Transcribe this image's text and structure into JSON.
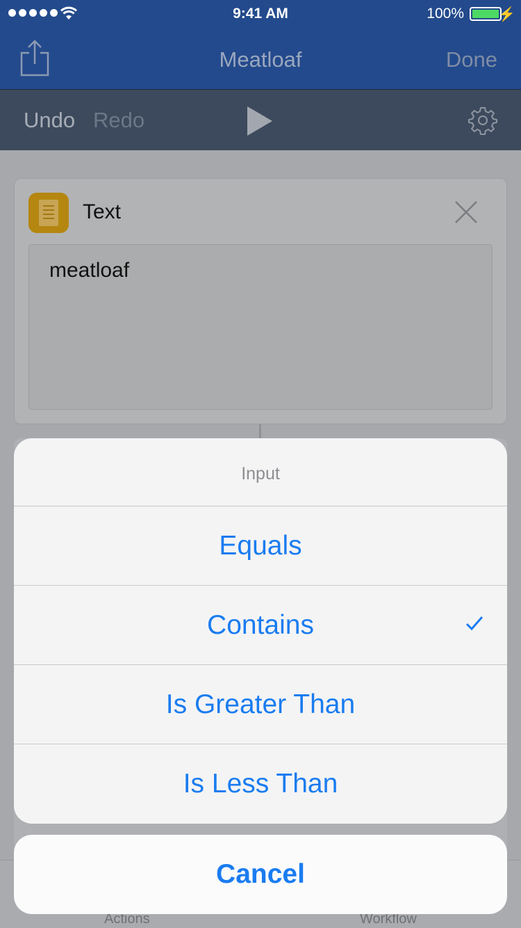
{
  "status_bar": {
    "time": "9:41 AM",
    "battery_percent": "100%",
    "battery_level": 1.0,
    "battery_color": "#4cd964"
  },
  "nav": {
    "title": "Meatloaf",
    "done_label": "Done",
    "share_icon": "share-icon"
  },
  "toolbar": {
    "undo_label": "Undo",
    "redo_label": "Redo",
    "play_icon": "play-icon",
    "settings_icon": "gear-icon"
  },
  "action_card": {
    "title": "Text",
    "icon": "text-document-icon",
    "value": "meatloaf"
  },
  "tab_bar": {
    "actions_label": "Actions",
    "workflow_label": "Workflow"
  },
  "action_sheet": {
    "title": "Input",
    "options": [
      {
        "label": "Equals",
        "selected": false
      },
      {
        "label": "Contains",
        "selected": true
      },
      {
        "label": "Is Greater Than",
        "selected": false
      },
      {
        "label": "Is Less Than",
        "selected": false
      }
    ],
    "cancel_label": "Cancel",
    "accent_color": "#1a7cf0"
  }
}
